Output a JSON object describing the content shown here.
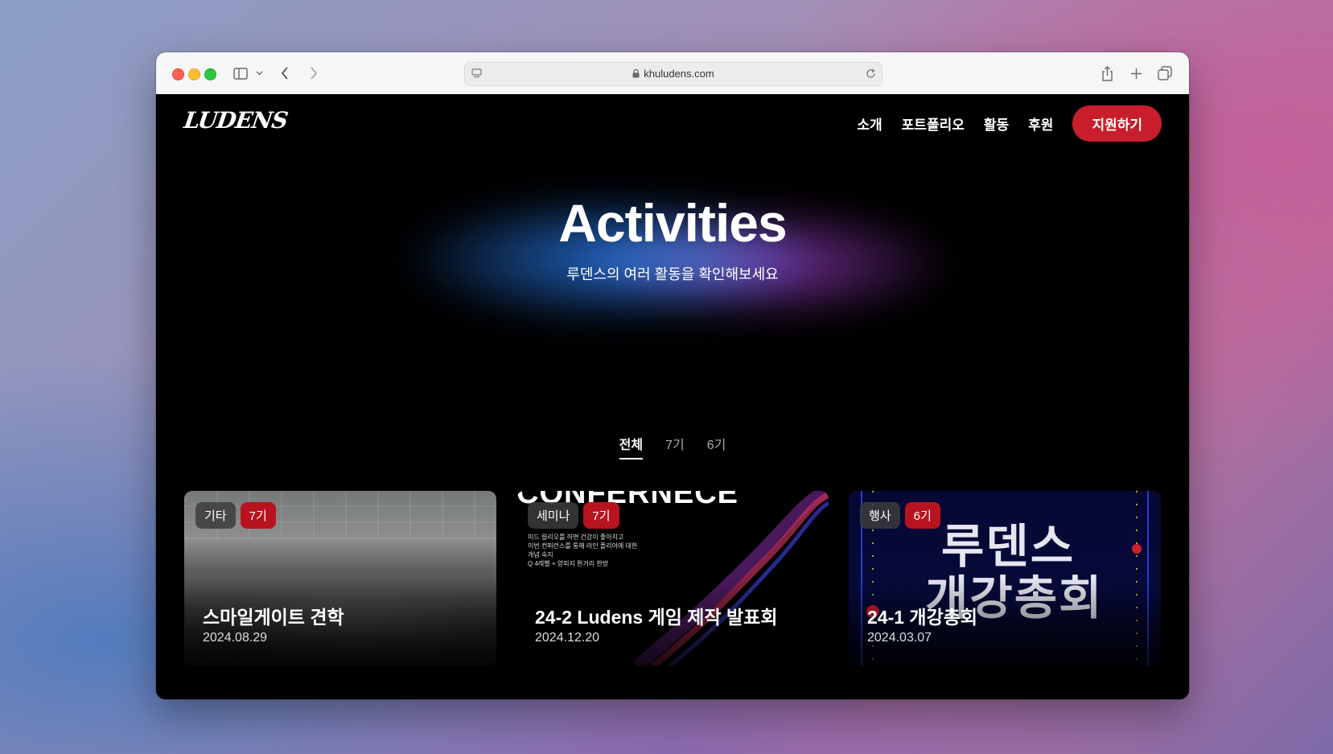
{
  "browser": {
    "url": "khuludens.com"
  },
  "site": {
    "logo": "LUDENS",
    "nav": [
      "소개",
      "포트폴리오",
      "활동",
      "후원"
    ],
    "apply_label": "지원하기"
  },
  "hero": {
    "title": "Activities",
    "subtitle": "루덴스의 여러 활동을 확인해보세요"
  },
  "filters": {
    "tabs": [
      "전체",
      "7기",
      "6기"
    ],
    "active": "전체"
  },
  "cards": [
    {
      "category": "기타",
      "generation": "7기",
      "title": "스마일게이트 견학",
      "date": "2024.08.29"
    },
    {
      "category": "세미나",
      "generation": "7기",
      "title": "24-2 Ludens 게임 제작 발표회",
      "date": "2024.12.20"
    },
    {
      "category": "행사",
      "generation": "6기",
      "title": "24-1 개강총회",
      "date": "2024.03.07"
    }
  ],
  "card_images": {
    "conference_text": "CONFERNECE",
    "conference_lines": [
      "미드 릴리오를 하면 건강이 좋아지고",
      "이번 컨퍼런스를 통해 라인 플리어에 대한",
      "개념 숙지",
      "Q 4레벨 + 양피지 뭔거리 한방"
    ],
    "poster_line1": "루덴스",
    "poster_line2": "개강총회"
  },
  "colors": {
    "accent": "#c81e2c",
    "badge_generation": "#b8141f"
  }
}
